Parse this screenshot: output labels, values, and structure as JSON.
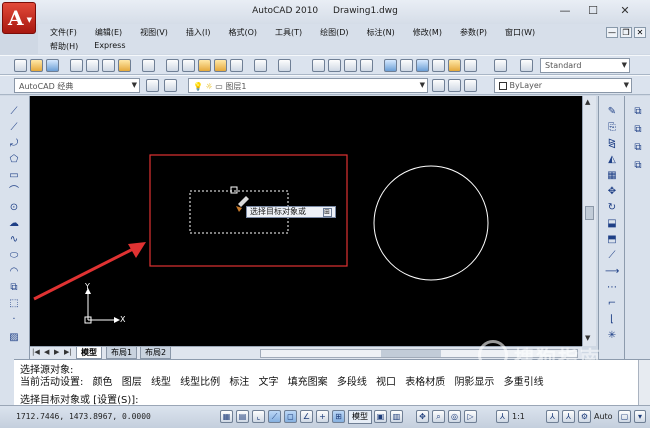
{
  "window": {
    "app_title": "AutoCAD 2010",
    "document_title": "Drawing1.dwg",
    "minimize": "—",
    "maximize": "☐",
    "close": "✕"
  },
  "app_button": {
    "letter": "A",
    "caret": "▼"
  },
  "menu": {
    "row1": [
      "文件(F)",
      "编辑(E)",
      "视图(V)",
      "插入(I)",
      "格式(O)",
      "工具(T)",
      "绘图(D)",
      "标注(N)",
      "修改(M)",
      "参数(P)",
      "窗口(W)"
    ],
    "row2": [
      "帮助(H)",
      "Express"
    ],
    "doc_controls": [
      "—",
      "❐",
      "✕"
    ]
  },
  "toolbar": {
    "workspace": "AutoCAD 经典",
    "layer": "图层1",
    "linetype": "ByLayer",
    "text_style": "Standard"
  },
  "drawing": {
    "tooltip": "选择目标对象或",
    "tooltip_btn": "⊞",
    "ucs_x": "X",
    "ucs_y": "Y",
    "highlight_color": "#e03232",
    "arrow_color": "#e03232"
  },
  "layout_tabs": [
    "模型",
    "布局1",
    "布局2"
  ],
  "command": {
    "line1": "选择源对象:",
    "line2_prefix": "当前活动设置:",
    "line2_options": [
      "颜色",
      "图层",
      "线型",
      "线型比例",
      "标注",
      "文字",
      "填充图案",
      "多段线",
      "视口",
      "表格材质",
      "阴影显示",
      "多重引线"
    ],
    "line3": "选择目标对象或 [设置(S)]:"
  },
  "status": {
    "coordinates": "1712.7446, 1473.8967, 0.0000",
    "model": "模型",
    "scale": "1:1",
    "auto": "Auto"
  },
  "watermark": {
    "text": "搜狗指南",
    "sub": "zhinan.sogou.com"
  }
}
